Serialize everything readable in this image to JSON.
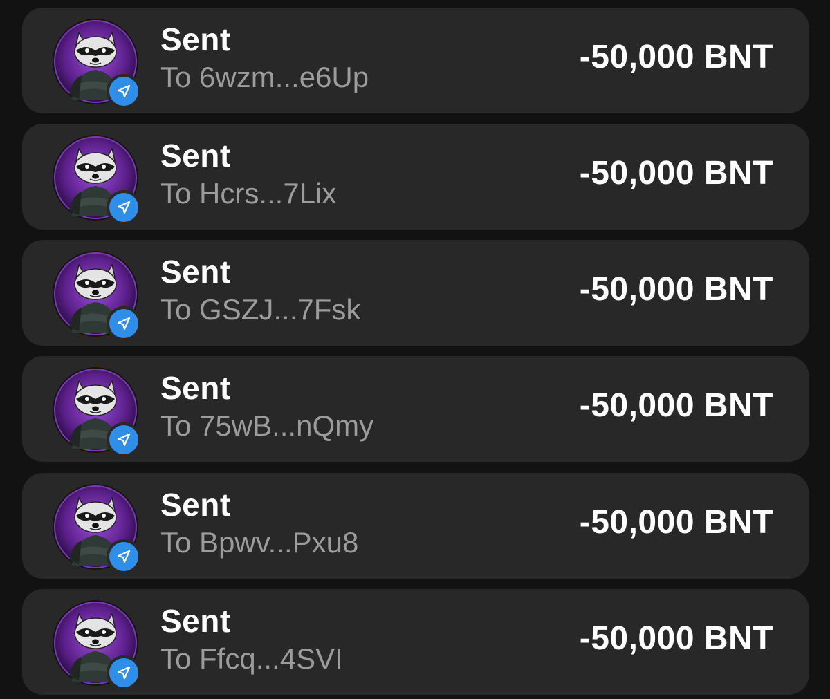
{
  "colors": {
    "background": "#121212",
    "row_background": "#282828",
    "title_text": "#ffffff",
    "subtitle_text": "#9c9c9c",
    "badge_blue": "#2f8ee8",
    "avatar_purple": "#6a2a9c"
  },
  "transactions": [
    {
      "title": "Sent",
      "subtitle": "To 6wzm...e6Up",
      "amount": "-50,000 BNT",
      "avatar_icon": "raccoon-avatar-icon",
      "badge_icon": "send-arrow-icon"
    },
    {
      "title": "Sent",
      "subtitle": "To Hcrs...7Lix",
      "amount": "-50,000 BNT",
      "avatar_icon": "raccoon-avatar-icon",
      "badge_icon": "send-arrow-icon"
    },
    {
      "title": "Sent",
      "subtitle": "To GSZJ...7Fsk",
      "amount": "-50,000 BNT",
      "avatar_icon": "raccoon-avatar-icon",
      "badge_icon": "send-arrow-icon"
    },
    {
      "title": "Sent",
      "subtitle": "To 75wB...nQmy",
      "amount": "-50,000 BNT",
      "avatar_icon": "raccoon-avatar-icon",
      "badge_icon": "send-arrow-icon"
    },
    {
      "title": "Sent",
      "subtitle": "To Bpwv...Pxu8",
      "amount": "-50,000 BNT",
      "avatar_icon": "raccoon-avatar-icon",
      "badge_icon": "send-arrow-icon"
    },
    {
      "title": "Sent",
      "subtitle": "To Ffcq...4SVI",
      "amount": "-50,000 BNT",
      "avatar_icon": "raccoon-avatar-icon",
      "badge_icon": "send-arrow-icon"
    }
  ]
}
